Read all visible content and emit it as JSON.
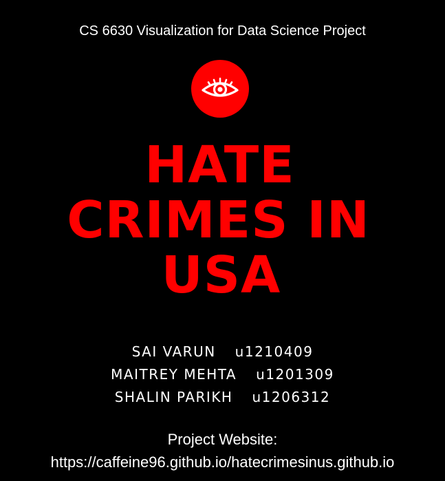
{
  "header": {
    "course_title": "CS 6630 Visualization for Data Science Project"
  },
  "logo": {
    "icon": "eye-icon",
    "circle_color": "#ff0000",
    "icon_color": "#ffffff"
  },
  "title": {
    "lines": [
      "HATE",
      "CRIMES IN",
      "USA"
    ],
    "color": "#ff0000"
  },
  "authors": [
    {
      "name": "SAI VARUN",
      "id": "u1210409"
    },
    {
      "name": "MAITREY MEHTA",
      "id": "u1201309"
    },
    {
      "name": "SHALIN PARIKH",
      "id": "u1206312"
    }
  ],
  "website": {
    "label": "Project Website:",
    "url": "https://caffeine96.github.io/hatecrimesinus.github.io"
  },
  "colors": {
    "background": "#000000",
    "text": "#ffffff",
    "accent": "#ff0000"
  }
}
